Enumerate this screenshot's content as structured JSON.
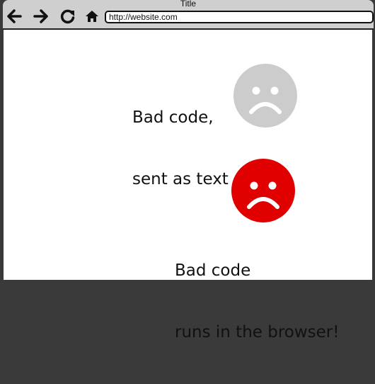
{
  "window": {
    "title": "Title"
  },
  "toolbar": {
    "back_icon": "back-arrow-icon",
    "forward_icon": "forward-arrow-icon",
    "reload_icon": "reload-icon",
    "home_icon": "home-icon",
    "url": "http://website.com"
  },
  "main": {
    "text_item": {
      "line1": "Bad code,",
      "line2": "sent as text",
      "face_icon": "sad-face-icon",
      "face_color": "#cccccc"
    },
    "browser_item": {
      "line1": "Bad code",
      "line2": "runs in the browser!",
      "face_icon": "sad-face-icon",
      "face_color": "#e00000"
    }
  }
}
